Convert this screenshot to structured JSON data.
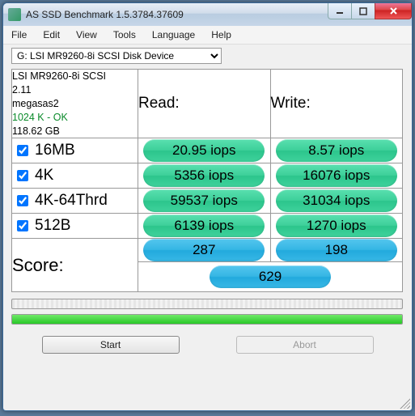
{
  "window": {
    "title": "AS SSD Benchmark 1.5.3784.37609"
  },
  "menu": {
    "file": "File",
    "edit": "Edit",
    "view": "View",
    "tools": "Tools",
    "language": "Language",
    "help": "Help"
  },
  "device": {
    "selected": "G: LSI MR9260-8i SCSI Disk Device"
  },
  "info": {
    "model": "LSI MR9260-8i SCSI",
    "firmware": "2.11",
    "driver": "megasas2",
    "alignment": "1024 K - OK",
    "capacity": "118.62 GB"
  },
  "headers": {
    "read": "Read:",
    "write": "Write:"
  },
  "rows": [
    {
      "label": "16MB",
      "read": "20.95 iops",
      "write": "8.57 iops"
    },
    {
      "label": "4K",
      "read": "5356 iops",
      "write": "16076 iops"
    },
    {
      "label": "4K-64Thrd",
      "read": "59537 iops",
      "write": "31034 iops"
    },
    {
      "label": "512B",
      "read": "6139 iops",
      "write": "1270 iops"
    }
  ],
  "score": {
    "label": "Score:",
    "read": "287",
    "write": "198",
    "total": "629"
  },
  "buttons": {
    "start": "Start",
    "abort": "Abort"
  },
  "progress": {
    "top_pct": 0,
    "bottom_pct": 100
  }
}
